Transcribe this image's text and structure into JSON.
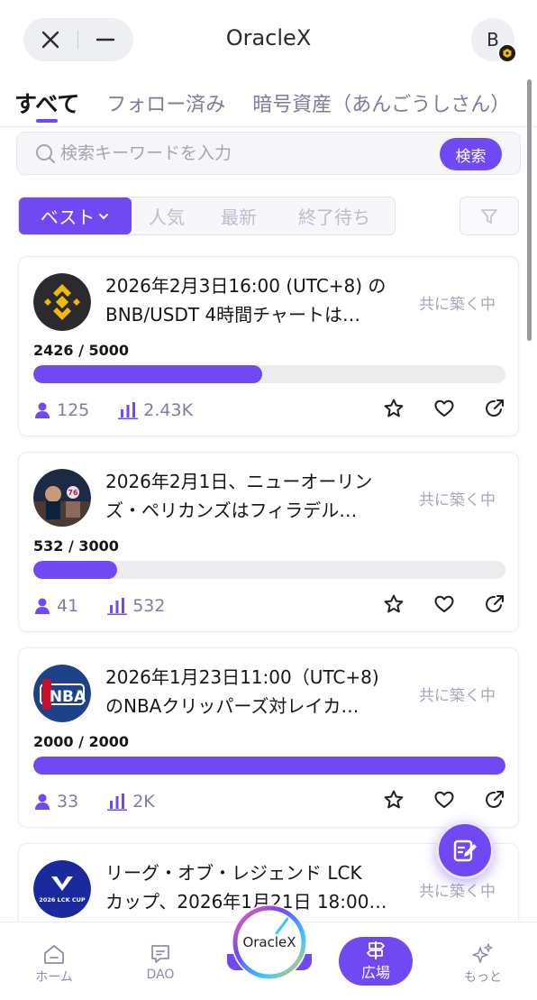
{
  "header": {
    "title": "OracleX",
    "avatar_initial": "B"
  },
  "tabs": [
    {
      "label": "すべて"
    },
    {
      "label": "フォロー済み"
    },
    {
      "label": "暗号資産（あんごうしさん）"
    }
  ],
  "search": {
    "placeholder": "検索キーワードを入力",
    "button": "検索"
  },
  "filters": {
    "active": "ベスト",
    "items": [
      "人気",
      "最新",
      "終了待ち"
    ]
  },
  "cards": [
    {
      "title_line1": "2026年2月3日16:00 (UTC+8) の",
      "title_line2": "BNB/USDT 4時間チャートは…",
      "status": "共に築く中",
      "count": "2426 / 5000",
      "progress": 0.4852,
      "participants": "125",
      "volume": "2.43K",
      "logo": "bnb-logo"
    },
    {
      "title_line1": "2026年2月1日、ニューオーリン",
      "title_line2": "ズ・ペリカンズはフィラデル…",
      "status": "共に築く中",
      "count": "532 / 3000",
      "progress": 0.1773,
      "participants": "41",
      "volume": "532",
      "logo": "basketball-match-logo"
    },
    {
      "title_line1": "2026年1月23日11:00（UTC+8)",
      "title_line2": "のNBAクリッパーズ対レイカ…",
      "status": "共に築く中",
      "count": "2000 / 2000",
      "progress": 1.0,
      "participants": "33",
      "volume": "2K",
      "logo": "nba-logo"
    },
    {
      "title_line1": "リーグ・オブ・レジェンド LCK",
      "title_line2": "カップ、2026年1月21日 18:00…",
      "status": "共に築く中",
      "logo": "lck-cup-logo",
      "logo_caption": "2026 LCK CUP"
    }
  ],
  "bottom_nav": {
    "home": "ホーム",
    "dao": "DAO",
    "center": "OracleX",
    "plaza": "広場",
    "more": "もっと"
  },
  "colors": {
    "accent": "#7149f3",
    "muted": "#7c7fa0"
  }
}
